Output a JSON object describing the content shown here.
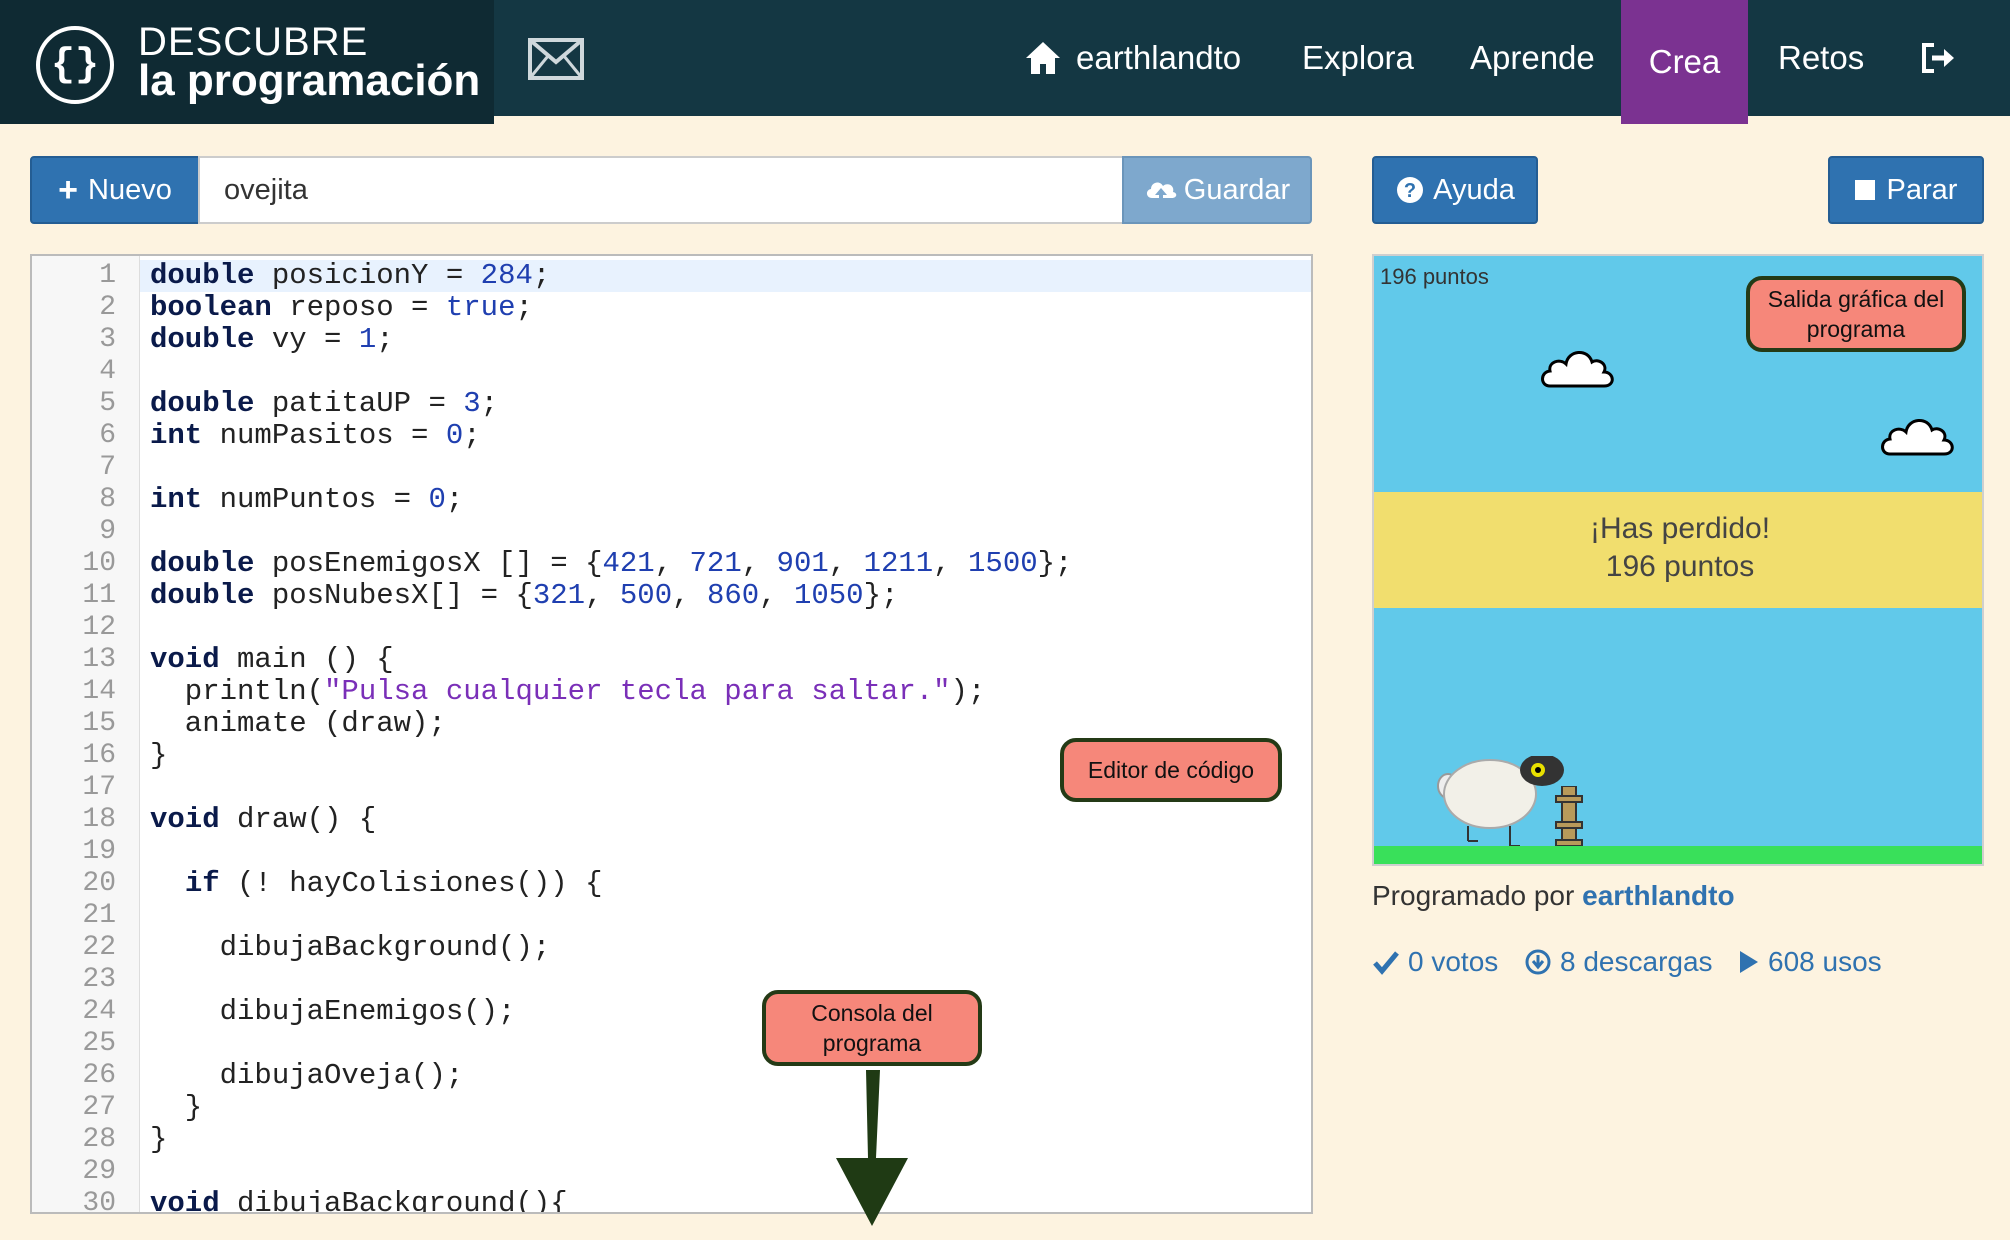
{
  "logo": {
    "symbol": "{}",
    "line1": "DESCUBRE",
    "line2": "la programación"
  },
  "nav": {
    "user": "earthlandto",
    "items": [
      "Explora",
      "Aprende",
      "Crea",
      "Retos"
    ],
    "active": "Crea",
    "active_color": "#7b3291"
  },
  "toolbar": {
    "new_label": "Nuevo",
    "program_name": "ovejita",
    "save_label": "Guardar"
  },
  "editor": {
    "line_numbers": [
      "1",
      "2",
      "3",
      "4",
      "5",
      "6",
      "7",
      "8",
      "9",
      "10",
      "11",
      "12",
      "13",
      "14",
      "15",
      "16",
      "17",
      "18",
      "19",
      "20",
      "21",
      "22",
      "23",
      "24",
      "25",
      "26",
      "27",
      "28",
      "29",
      "30"
    ],
    "lines": [
      "double posicionY = 284;",
      "boolean reposo = true;",
      "double vy = 1;",
      "",
      "double patitaUP = 3;",
      "int numPasitos = 0;",
      "",
      "int numPuntos = 0;",
      "",
      "double posEnemigosX [] = {421, 721, 901, 1211, 1500};",
      "double posNubesX[] = {321, 500, 860, 1050};",
      "",
      "void main () {",
      "  println(\"Pulsa cualquier tecla para saltar.\");",
      "  animate (draw);",
      "}",
      "",
      "void draw() {",
      "",
      "  if (! hayColisiones()) {",
      "",
      "    dibujaBackground();",
      "",
      "    dibujaEnemigos();",
      "",
      "    dibujaOveja();",
      "  }",
      "}",
      "",
      "void dibujaBackground(){"
    ]
  },
  "annotations": {
    "editor": "Editor de código",
    "console": "Consola del programa",
    "output": "Salida gráfica del programa"
  },
  "right": {
    "help_label": "Ayuda",
    "stop_label": "Parar",
    "canvas": {
      "score_text": "196 puntos",
      "lost_line1": "¡Has perdido!",
      "lost_line2": "196 puntos",
      "sky_color": "#61c9ea",
      "band_color": "#f1de6e",
      "ground_color": "#39e05a"
    },
    "author_prefix": "Programado por",
    "author": "earthlandto",
    "stats": {
      "votes": "0 votos",
      "downloads": "8 descargas",
      "uses": "608 usos"
    }
  }
}
